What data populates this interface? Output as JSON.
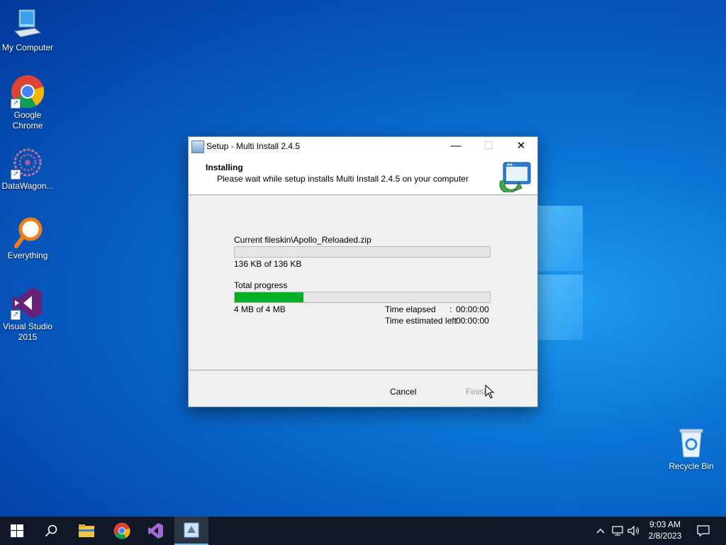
{
  "desktop": {
    "icons": [
      {
        "label": "My Computer"
      },
      {
        "label": "Google Chrome"
      },
      {
        "label": "DataWagon..."
      },
      {
        "label": "Everything"
      },
      {
        "label": "Visual Studio 2015"
      }
    ],
    "recycle_bin": {
      "label": "Recycle Bin"
    }
  },
  "dialog": {
    "title": "Setup - Multi Install 2.4.5",
    "header_title": "Installing",
    "header_subtitle": "Please wait while setup installs Multi Install 2.4.5 on your computer",
    "current_file_label": "Current file:",
    "current_file_value": "skin\\Apollo_Reloaded.zip",
    "file_size_text": "136 KB of 136 KB",
    "file_progress": 0,
    "total_label": "Total progress",
    "total_size_text": "4 MB  of 4 MB",
    "total_progress": 0.27,
    "time_elapsed_label": "Time elapsed",
    "time_elapsed_value": "00:00:00",
    "time_estimated_label": "Time estimated left",
    "time_estimated_value": "00:00:00",
    "colon": ":",
    "cancel_label": "Cancel",
    "finish_label": "Finish",
    "minimize_glyph": "—",
    "maximize_glyph": "☐",
    "close_glyph": "✕",
    "progress_color": "#06b025"
  },
  "taskbar": {
    "clock_time": "9:03 AM",
    "clock_date": "2/8/2023",
    "tray_icons": [
      "chevron-up-icon",
      "network-icon",
      "volume-icon",
      "notification-icon"
    ]
  }
}
